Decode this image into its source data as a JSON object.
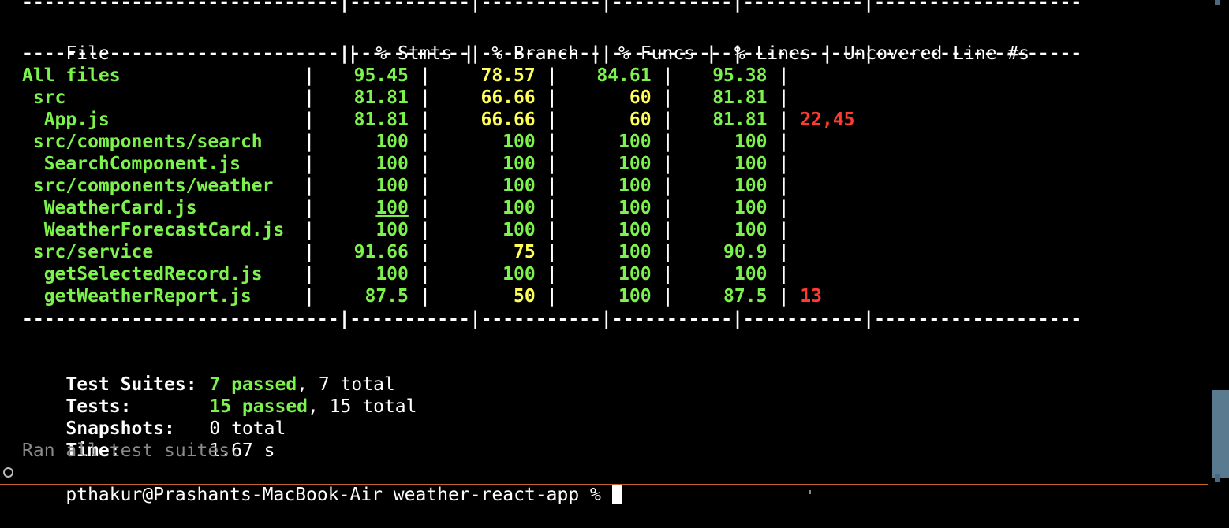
{
  "separator_line": "-----------------------------|-----------|-----------|-----------|-----------|-------------------",
  "separator_top": "-----------------------------|-----------|-----------|-----------|-----------|-------------------",
  "headers": {
    "file": "File",
    "stmts": "% Stmts",
    "branch": "% Branch",
    "funcs": "% Funcs",
    "lines": "% Lines",
    "uncovered": "Uncovered Line #s"
  },
  "rows": [
    {
      "file": "All files",
      "stmts": "95.45",
      "branch": "78.57",
      "funcs": "84.61",
      "lines": "95.38",
      "uncovered": ""
    },
    {
      "file": " src",
      "stmts": "81.81",
      "branch": "66.66",
      "funcs": "60",
      "lines": "81.81",
      "uncovered": ""
    },
    {
      "file": "  App.js",
      "stmts": "81.81",
      "branch": "66.66",
      "funcs": "60",
      "lines": "81.81",
      "uncovered": "22,45"
    },
    {
      "file": " src/components/search",
      "stmts": "100",
      "branch": "100",
      "funcs": "100",
      "lines": "100",
      "uncovered": ""
    },
    {
      "file": "  SearchComponent.js",
      "stmts": "100",
      "branch": "100",
      "funcs": "100",
      "lines": "100",
      "uncovered": ""
    },
    {
      "file": " src/components/weather",
      "stmts": "100",
      "branch": "100",
      "funcs": "100",
      "lines": "100",
      "uncovered": ""
    },
    {
      "file": "  WeatherCard.js",
      "stmts": "100",
      "branch": "100",
      "funcs": "100",
      "lines": "100",
      "uncovered": ""
    },
    {
      "file": "  WeatherForecastCard.js",
      "stmts": "100",
      "branch": "100",
      "funcs": "100",
      "lines": "100",
      "uncovered": ""
    },
    {
      "file": " src/service",
      "stmts": "91.66",
      "branch": "75",
      "funcs": "100",
      "lines": "90.9",
      "uncovered": ""
    },
    {
      "file": "  getSelectedRecord.js",
      "stmts": "100",
      "branch": "100",
      "funcs": "100",
      "lines": "100",
      "uncovered": ""
    },
    {
      "file": "  getWeatherReport.js",
      "stmts": "87.5",
      "branch": "50",
      "funcs": "100",
      "lines": "87.5",
      "uncovered": "13"
    }
  ],
  "summary": {
    "suites_label": "Test Suites:",
    "suites_passed": "7 passed",
    "suites_total": ", 7 total",
    "tests_label": "Tests:",
    "tests_passed": "15 passed",
    "tests_total": ", 15 total",
    "snapshots_label": "Snapshots:",
    "snapshots_value": "0 total",
    "time_label": "Time:",
    "time_value": "1.67 s",
    "ran_all": "Ran all test suites."
  },
  "prompt": {
    "text": "pthakur@Prashants-MacBook-Air weather-react-app % "
  },
  "colors": {
    "background": "#000000",
    "green": "#7cf24c",
    "yellow": "#ffff55",
    "red": "#ff3b30",
    "white": "#ffffff",
    "dim": "#8a8a8a"
  }
}
